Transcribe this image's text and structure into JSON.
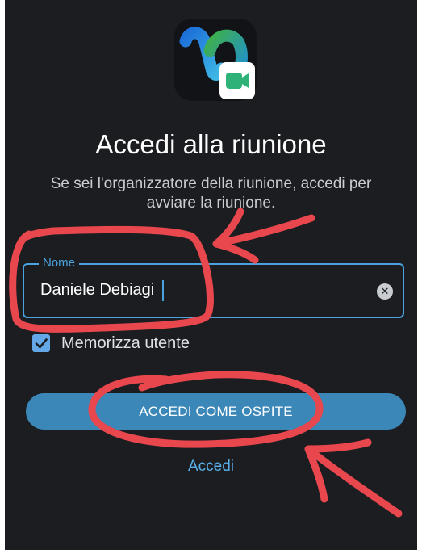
{
  "colors": {
    "background": "#1b1d21",
    "accent": "#4aa3df",
    "button": "#3a87b8",
    "link": "#5ab0ea",
    "annotation": "#e8474e"
  },
  "app_icon": {
    "name": "webex-logo"
  },
  "title": "Accedi alla riunione",
  "subtitle": "Se sei l'organizzatore della riunione, accedi per avviare la riunione.",
  "name_field": {
    "label": "Nome",
    "value": "Daniele Debiagi",
    "clear_icon": "clear-icon"
  },
  "remember": {
    "label": "Memorizza utente",
    "checked": true
  },
  "guest_button": {
    "label": "ACCEDI COME OSPITE"
  },
  "signin_link": {
    "label": "Accedi"
  }
}
